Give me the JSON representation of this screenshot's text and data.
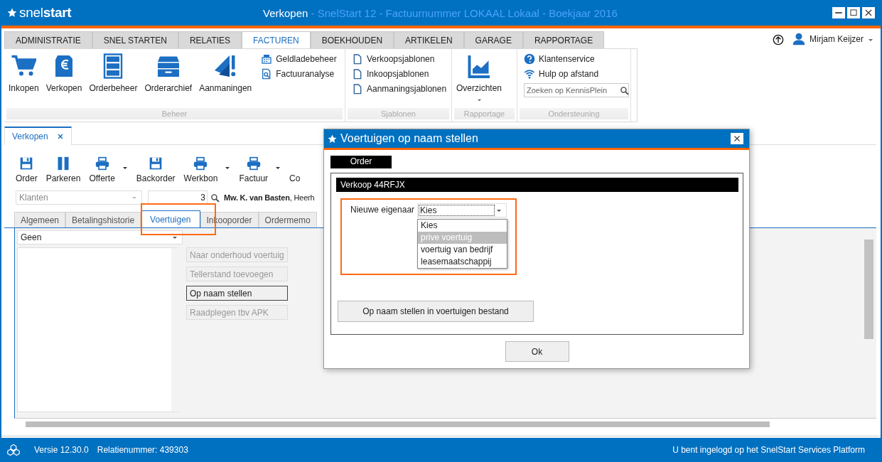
{
  "window": {
    "logo": "snel**start**",
    "title": "Verkopen",
    "subtitle": " - SnelStart 12 - Factuurnummer LOKAAL Lokaal - Boekjaar 2016"
  },
  "ribbon_tabs": [
    {
      "label": "ADMINISTRATIE",
      "selected": false
    },
    {
      "label": "SNEL STARTEN",
      "selected": false
    },
    {
      "label": "RELATIES",
      "selected": false
    },
    {
      "label": "FACTUREN",
      "selected": true
    },
    {
      "label": "BOEKHOUDEN",
      "selected": false
    },
    {
      "label": "ARTIKELEN",
      "selected": false
    },
    {
      "label": "GARAGE",
      "selected": false
    },
    {
      "label": "RAPPORTAGE",
      "selected": false
    }
  ],
  "user": {
    "name": "Mirjam Keijzer"
  },
  "ribbon_groups": [
    {
      "label": "Beheer",
      "large_items": [
        "Inkopen",
        "Verkopen",
        "Orderbeheer",
        "Orderarchief",
        "Aanmaningen"
      ],
      "small_items": [
        "Geldladebeheer",
        "Factuuranalyse"
      ]
    },
    {
      "label": "Sjablonen",
      "small_items": [
        "Verkoopsjablonen",
        "Inkoopsjablonen",
        "Aanmaningsjablonen"
      ]
    },
    {
      "label": "Rapportage",
      "large_items": [
        "Overzichten"
      ]
    },
    {
      "label": "Ondersteuning",
      "small_items": [
        "Klantenservice",
        "Hulp op afstand"
      ],
      "search": {
        "placeholder": "Zoeken op KennisPlein"
      }
    }
  ],
  "document_tabs": [
    {
      "label": "Verkopen",
      "selected": true
    }
  ],
  "toolbar": [
    {
      "label": "Order",
      "has_menu": false
    },
    {
      "label": "Parkeren",
      "has_menu": false
    },
    {
      "label": "Offerte",
      "has_menu": true
    },
    {
      "label": "Backorder",
      "has_menu": false
    },
    {
      "label": "Werkbon",
      "has_menu": true
    },
    {
      "label": "Factuur",
      "has_menu": true
    },
    {
      "label": "Co",
      "has_menu": false
    }
  ],
  "customer": {
    "relation_type": "Klanten",
    "number": "3",
    "name": "**Mw. K. van Basten**, Heerh"
  },
  "detail_tabs": [
    {
      "label": "Algemeen",
      "selected": false
    },
    {
      "label": "Betalingshistorie",
      "selected": false
    },
    {
      "label": "Voertuigen",
      "selected": true
    },
    {
      "label": "Inkooporder",
      "selected": false
    },
    {
      "label": "Ordermemo",
      "selected": false
    }
  ],
  "vehicle_select": {
    "value": "Geen"
  },
  "vehicle_actions": [
    {
      "label": "Naar onderhoud voertuig",
      "disabled": true
    },
    {
      "label": "Tellerstand toevoegen",
      "disabled": true
    },
    {
      "label": "Op naam stellen",
      "disabled": false
    },
    {
      "label": "Raadplegen tbv APK",
      "disabled": true
    }
  ],
  "dialog": {
    "title": "Voertuigen op naam stellen",
    "tab": "Order",
    "section": "Verkoop 44RFJX",
    "owner_label": "Nieuwe eigenaar",
    "owner_value": "Kies",
    "options": [
      {
        "label": "Kies",
        "selected": false
      },
      {
        "label": "prive voertuig",
        "selected": true
      },
      {
        "label": "voertuig van bedrijf",
        "selected": false
      },
      {
        "label": "leasemaatschappij",
        "selected": false
      }
    ],
    "action_button": "Op naam stellen in voertuigen bestand",
    "ok_button": "Ok"
  },
  "status_bar": {
    "version": "Versie 12.30.0",
    "relation": "Relatienummer: 439303",
    "login": "U bent ingelogd op het SnelStart Services Platform"
  }
}
